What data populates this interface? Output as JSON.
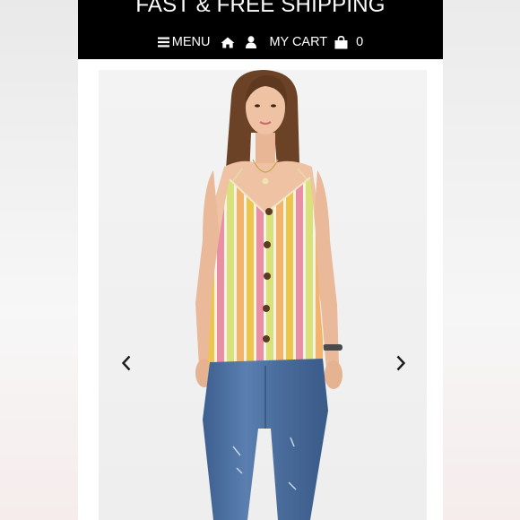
{
  "header": {
    "promo_text": "FAST & FREE SHIPPING",
    "menu_label": "MENU",
    "cart_label": "MY CART",
    "cart_count": "0"
  },
  "icons": {
    "menu": "hamburger-icon",
    "home": "home-icon",
    "account": "user-icon",
    "cart": "shopping-bag-icon",
    "previous": "chevron-left-icon",
    "next": "chevron-right-icon"
  },
  "colors": {
    "header_bg": "#000000",
    "header_text": "#ffffff",
    "page_bg": "#ffffff",
    "image_bg": "#f2f2f2"
  }
}
